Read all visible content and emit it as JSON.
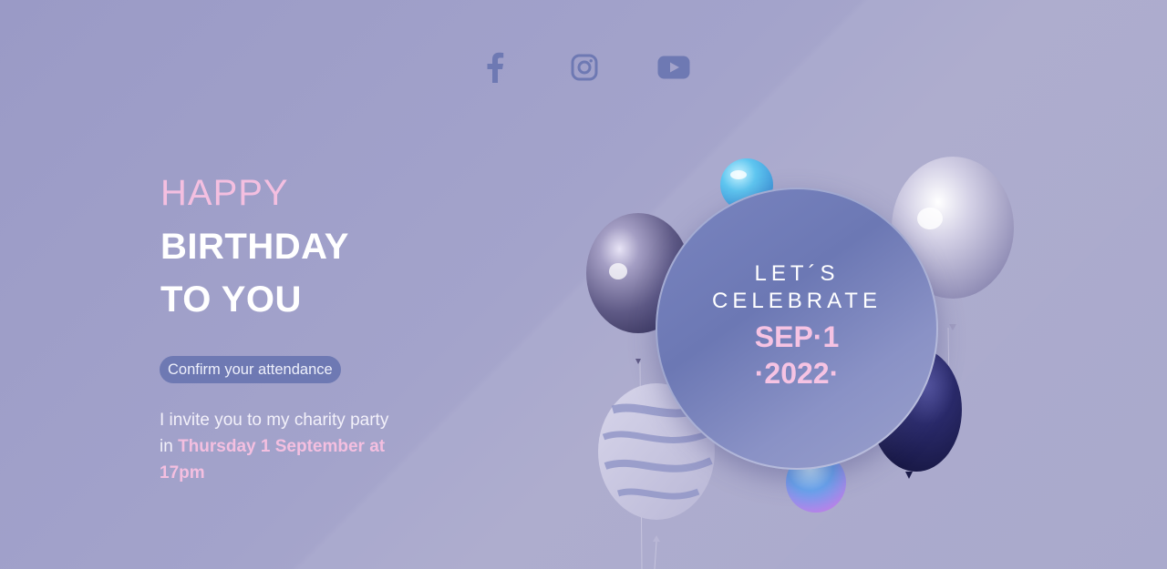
{
  "social": {
    "icons": [
      "facebook-icon",
      "instagram-icon",
      "youtube-icon"
    ],
    "icon_color": "#6e79b3"
  },
  "headline": {
    "line1": "HAPPY",
    "line2": "BIRTHDAY",
    "line3": "TO YOU"
  },
  "confirm_button": {
    "label": "Confirm your attendance"
  },
  "invite": {
    "text_start": "I invite you to my charity party in ",
    "highlight": "Thursday 1 September at 17pm"
  },
  "badge": {
    "line1": "LET´S",
    "line2": "CELEBRATE",
    "line3": "SEP·1",
    "line4": "·2022·"
  },
  "colors": {
    "background": "#a3a3cb",
    "pink_accent": "#f4bfe0",
    "button_bg": "#6e79b3",
    "badge_bg": "#7a85c0"
  }
}
